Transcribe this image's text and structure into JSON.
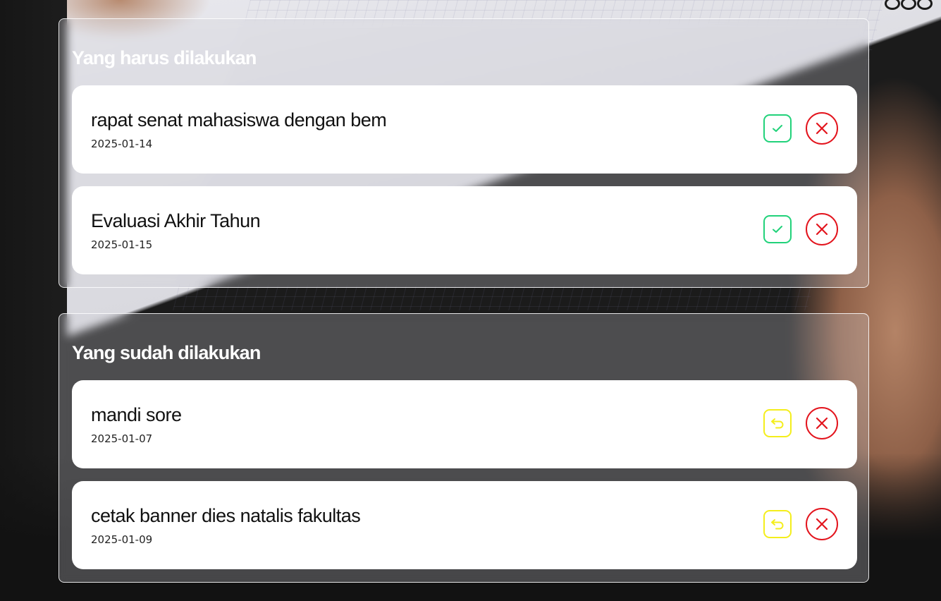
{
  "colors": {
    "done_button": "#21d27a",
    "undo_button": "#f4ee1c",
    "delete_button": "#e3141d",
    "card_background": "#ffffff",
    "heading_text": "#ffffff"
  },
  "todo": {
    "heading": "Yang harus dilakukan",
    "tasks": [
      {
        "title": "rapat senat mahasiswa dengan bem",
        "date": "2025-01-14",
        "action_icon": "check-icon",
        "delete_icon": "close-icon"
      },
      {
        "title": "Evaluasi Akhir Tahun",
        "date": "2025-01-15",
        "action_icon": "check-icon",
        "delete_icon": "close-icon"
      }
    ]
  },
  "done": {
    "heading": "Yang sudah dilakukan",
    "tasks": [
      {
        "title": "mandi sore",
        "date": "2025-01-07",
        "action_icon": "undo-icon",
        "delete_icon": "close-icon"
      },
      {
        "title": "cetak banner dies natalis fakultas",
        "date": "2025-01-09",
        "action_icon": "undo-icon",
        "delete_icon": "close-icon"
      }
    ]
  }
}
